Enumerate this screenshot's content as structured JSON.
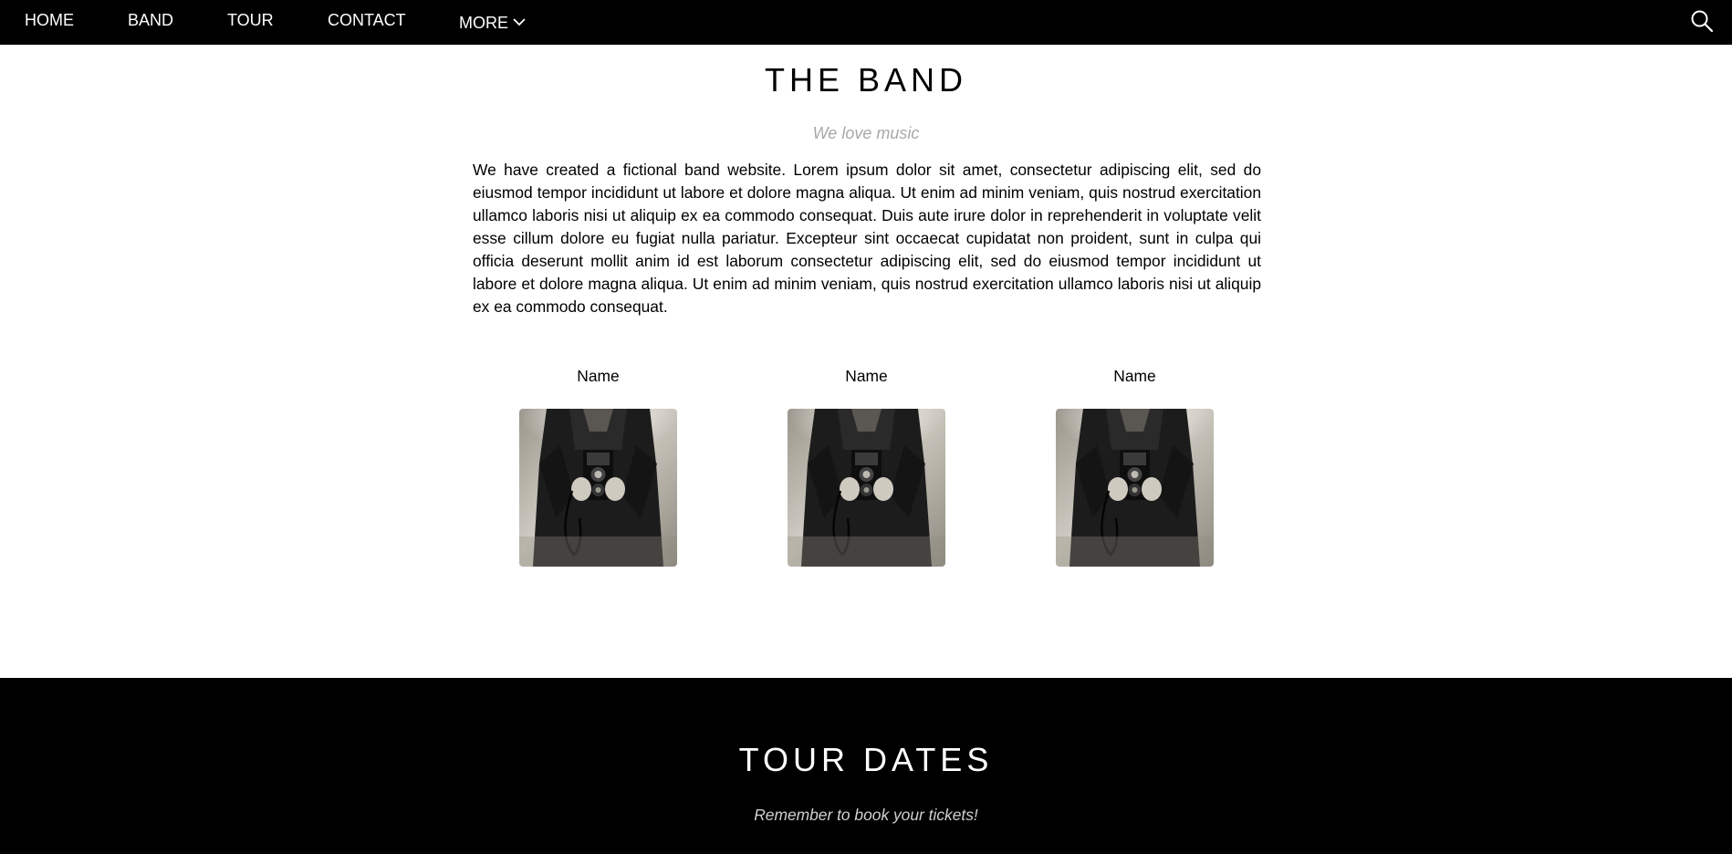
{
  "nav": {
    "items": [
      {
        "label": "HOME"
      },
      {
        "label": "BAND"
      },
      {
        "label": "TOUR"
      },
      {
        "label": "CONTACT"
      },
      {
        "label": "MORE"
      }
    ],
    "more_icon": "chevron-down-icon",
    "search_icon": "search-icon"
  },
  "band": {
    "title": "THE BAND",
    "subtitle": "We love music",
    "description": "We have created a fictional band website. Lorem ipsum dolor sit amet, consectetur adipiscing elit, sed do eiusmod tempor incididunt ut labore et dolore magna aliqua. Ut enim ad minim veniam, quis nostrud exercitation ullamco laboris nisi ut aliquip ex ea commodo consequat. Duis aute irure dolor in reprehenderit in voluptate velit esse cillum dolore eu fugiat nulla pariatur. Excepteur sint occaecat cupidatat non proident, sunt in culpa qui officia deserunt mollit anim id est laborum consectetur adipiscing elit, sed do eiusmod tempor incididunt ut labore et dolore magna aliqua. Ut enim ad minim veniam, quis nostrud exercitation ullamco laboris nisi ut aliquip ex ea commodo consequat.",
    "members": [
      {
        "name": "Name"
      },
      {
        "name": "Name"
      },
      {
        "name": "Name"
      }
    ]
  },
  "tour": {
    "title": "TOUR DATES",
    "subtitle": "Remember to book your tickets!"
  },
  "colors": {
    "nav_bg": "#000000",
    "nav_text": "#ffffff",
    "subtitle_gray": "#a8a8a8",
    "tour_bg": "#000000"
  }
}
